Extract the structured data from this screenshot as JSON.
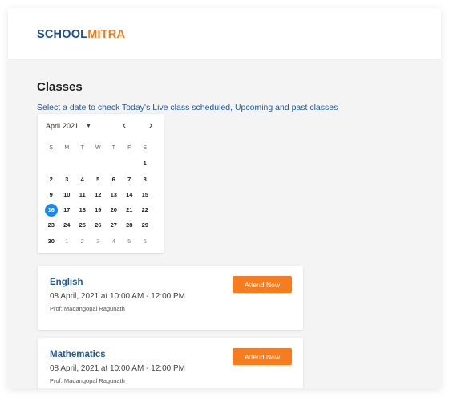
{
  "brand": {
    "part1": "SCHOOL",
    "part2": "MITRA",
    "color_primary": "#1d4f94",
    "color_accent": "#f07c1b"
  },
  "page": {
    "title": "Classes",
    "subtitle": "Select a date to check Today's Live class scheduled, Upcoming and past classes"
  },
  "calendar": {
    "month": "April",
    "year": "2021",
    "dropdown_icon": "caret-down-icon",
    "prev_icon": "chevron-left-icon",
    "prev_glyph": "‹",
    "next_icon": "chevron-right-icon",
    "next_glyph": "›",
    "weekdays": [
      "S",
      "M",
      "T",
      "W",
      "T",
      "F",
      "S"
    ],
    "weeks": [
      [
        "",
        "",
        "",
        "",
        "",
        "",
        "1"
      ],
      [
        "2",
        "3",
        "4",
        "5",
        "6",
        "7",
        "8"
      ],
      [
        "9",
        "10",
        "11",
        "12",
        "13",
        "14",
        "15"
      ],
      [
        "16",
        "17",
        "18",
        "19",
        "20",
        "21",
        "22"
      ],
      [
        "23",
        "24",
        "25",
        "26",
        "27",
        "28",
        "29"
      ],
      [
        "30",
        "1",
        "2",
        "3",
        "4",
        "5",
        "6"
      ]
    ],
    "selected_day": "16",
    "selected_color": "#1e88e5"
  },
  "classes": [
    {
      "subject": "English",
      "time": "08 April, 2021 at 10:00 AM - 12:00 PM",
      "professor": "Prof: Madangopal Ragunath",
      "button_label": "Attend Now"
    },
    {
      "subject": "Mathematics",
      "time": "08 April, 2021 at 10:00 AM - 12:00 PM",
      "professor": "Prof: Madangopal Ragunath",
      "button_label": "Attend Now"
    }
  ],
  "button_color": "#f57c1f"
}
